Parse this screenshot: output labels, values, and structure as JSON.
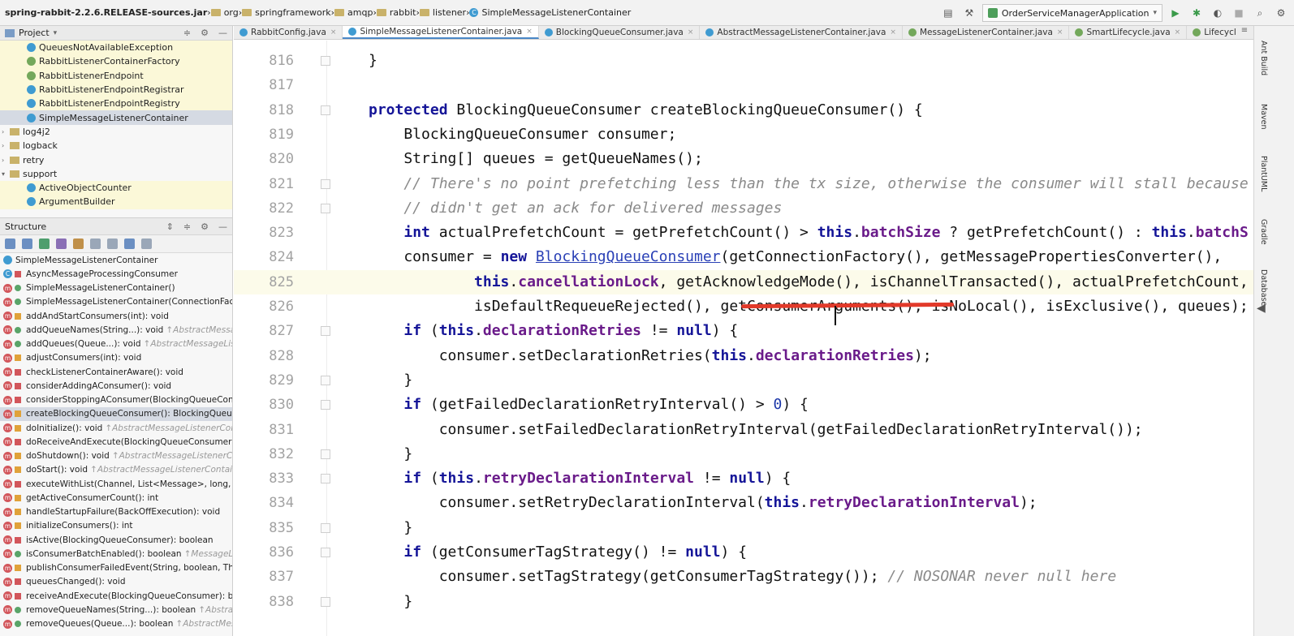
{
  "breadcrumbs": [
    {
      "label": "spring-rabbit-2.2.6.RELEASE-sources.jar",
      "kind": "jar"
    },
    {
      "label": "org",
      "kind": "folder"
    },
    {
      "label": "springframework",
      "kind": "folder"
    },
    {
      "label": "amqp",
      "kind": "folder"
    },
    {
      "label": "rabbit",
      "kind": "folder"
    },
    {
      "label": "listener",
      "kind": "folder"
    },
    {
      "label": "SimpleMessageListenerContainer",
      "kind": "class"
    }
  ],
  "run_config": {
    "label": "OrderServiceManagerApplication"
  },
  "project_panel": {
    "title": "Project",
    "tree": [
      {
        "label": "QueuesNotAvailableException",
        "icon": "class-icon"
      },
      {
        "label": "RabbitListenerContainerFactory",
        "icon": "interface-icon"
      },
      {
        "label": "RabbitListenerEndpoint",
        "icon": "interface-icon"
      },
      {
        "label": "RabbitListenerEndpointRegistrar",
        "icon": "class-icon"
      },
      {
        "label": "RabbitListenerEndpointRegistry",
        "icon": "class-icon"
      },
      {
        "label": "SimpleMessageListenerContainer",
        "icon": "class-icon",
        "selected": true
      },
      {
        "label": "log4j2",
        "icon": "folder-icon"
      },
      {
        "label": "logback",
        "icon": "folder-icon"
      },
      {
        "label": "retry",
        "icon": "folder-icon"
      },
      {
        "label": "support",
        "icon": "folder-icon",
        "expanded": true
      },
      {
        "label": "ActiveObjectCounter",
        "icon": "class-icon"
      },
      {
        "label": "ArgumentBuilder",
        "icon": "class-icon"
      }
    ]
  },
  "structure_panel": {
    "title": "Structure",
    "root": "SimpleMessageListenerContainer",
    "items": [
      {
        "label": "AsyncMessageProcessingConsumer",
        "source": "",
        "vis": "priv",
        "kind": "class"
      },
      {
        "label": "SimpleMessageListenerContainer()",
        "source": "",
        "vis": "pub"
      },
      {
        "label": "SimpleMessageListenerContainer(ConnectionFactory)",
        "source": "",
        "vis": "pub"
      },
      {
        "label": "addAndStartConsumers(int): void",
        "source": "",
        "vis": "prot"
      },
      {
        "label": "addQueueNames(String...): void",
        "source": "↑AbstractMessageListenerContainer",
        "vis": "pub"
      },
      {
        "label": "addQueues(Queue...): void",
        "source": "↑AbstractMessageListenerContainer",
        "vis": "pub"
      },
      {
        "label": "adjustConsumers(int): void",
        "source": "",
        "vis": "prot"
      },
      {
        "label": "checkListenerContainerAware(): void",
        "source": "",
        "vis": "priv"
      },
      {
        "label": "considerAddingAConsumer(): void",
        "source": "",
        "vis": "priv"
      },
      {
        "label": "considerStoppingAConsumer(BlockingQueueConsumer): void",
        "source": "",
        "vis": "priv"
      },
      {
        "label": "createBlockingQueueConsumer(): BlockingQueueConsumer",
        "source": "",
        "vis": "prot",
        "selected": true
      },
      {
        "label": "doInitialize(): void",
        "source": "↑AbstractMessageListenerContainer",
        "vis": "prot"
      },
      {
        "label": "doReceiveAndExecute(BlockingQueueConsumer): boolean",
        "source": "",
        "vis": "priv"
      },
      {
        "label": "doShutdown(): void",
        "source": "↑AbstractMessageListenerContainer",
        "vis": "prot"
      },
      {
        "label": "doStart(): void",
        "source": "↑AbstractMessageListenerContainer",
        "vis": "prot"
      },
      {
        "label": "executeWithList(Channel, List<Message>, long, BlockingQueueConsumer)",
        "source": "",
        "vis": "priv"
      },
      {
        "label": "getActiveConsumerCount(): int",
        "source": "",
        "vis": "prot"
      },
      {
        "label": "handleStartupFailure(BackOffExecution): void",
        "source": "",
        "vis": "prot"
      },
      {
        "label": "initializeConsumers(): int",
        "source": "",
        "vis": "prot"
      },
      {
        "label": "isActive(BlockingQueueConsumer): boolean",
        "source": "",
        "vis": "priv"
      },
      {
        "label": "isConsumerBatchEnabled(): boolean",
        "source": "↑MessageListenerContainer",
        "vis": "pub"
      },
      {
        "label": "publishConsumerFailedEvent(String, boolean, Throwable): void",
        "source": "",
        "vis": "prot"
      },
      {
        "label": "queuesChanged(): void",
        "source": "",
        "vis": "priv"
      },
      {
        "label": "receiveAndExecute(BlockingQueueConsumer): boolean",
        "source": "",
        "vis": "priv"
      },
      {
        "label": "removeQueueNames(String...): boolean",
        "source": "↑AbstractMessageListenerContainer",
        "vis": "pub"
      },
      {
        "label": "removeQueues(Queue...): boolean",
        "source": "↑AbstractMessageListenerContainer",
        "vis": "pub"
      }
    ]
  },
  "editor_tabs": [
    {
      "label": "RabbitConfig.java",
      "icon": "class"
    },
    {
      "label": "SimpleMessageListenerContainer.java",
      "icon": "class",
      "active": true
    },
    {
      "label": "BlockingQueueConsumer.java",
      "icon": "class"
    },
    {
      "label": "AbstractMessageListenerContainer.java",
      "icon": "class"
    },
    {
      "label": "MessageListenerContainer.java",
      "icon": "interface"
    },
    {
      "label": "SmartLifecycle.java",
      "icon": "interface"
    },
    {
      "label": "Lifecycle.java",
      "icon": "interface"
    }
  ],
  "right_tools": [
    "Ant Build",
    "Maven",
    "PlantUML",
    "Gradle",
    "Database"
  ],
  "code": {
    "current_line": "825",
    "lines": [
      {
        "n": "816",
        "fold": true,
        "tokens": [
          {
            "t": "}",
            "c": ""
          }
        ]
      },
      {
        "n": "817",
        "fold": false,
        "tokens": []
      },
      {
        "n": "818",
        "fold": true,
        "tokens": [
          {
            "t": "protected ",
            "c": "kw"
          },
          {
            "t": "BlockingQueueConsumer createBlockingQueueConsumer() {",
            "c": ""
          }
        ]
      },
      {
        "n": "819",
        "fold": false,
        "tokens": [
          {
            "t": "    BlockingQueueConsumer consumer;",
            "c": ""
          }
        ]
      },
      {
        "n": "820",
        "fold": false,
        "tokens": [
          {
            "t": "    String[] queues = getQueueNames();",
            "c": ""
          }
        ]
      },
      {
        "n": "821",
        "fold": true,
        "tokens": [
          {
            "t": "    // There's no point prefetching less than the tx size, otherwise the consumer will stall because t",
            "c": "cmt"
          }
        ]
      },
      {
        "n": "822",
        "fold": true,
        "tokens": [
          {
            "t": "    // didn't get an ack for delivered messages",
            "c": "cmt"
          }
        ]
      },
      {
        "n": "823",
        "fold": false,
        "tokens": [
          {
            "t": "    ",
            "c": ""
          },
          {
            "t": "int ",
            "c": "kw"
          },
          {
            "t": "actualPrefetchCount = getPrefetchCount() > ",
            "c": ""
          },
          {
            "t": "this",
            "c": "kw"
          },
          {
            "t": ".",
            "c": ""
          },
          {
            "t": "batchSize",
            "c": "fld"
          },
          {
            "t": " ? getPrefetchCount() : ",
            "c": ""
          },
          {
            "t": "this",
            "c": "kw"
          },
          {
            "t": ".",
            "c": ""
          },
          {
            "t": "batchS",
            "c": "fld"
          }
        ]
      },
      {
        "n": "824",
        "fold": false,
        "tokens": [
          {
            "t": "    consumer = ",
            "c": ""
          },
          {
            "t": "new ",
            "c": "kw"
          },
          {
            "t": "BlockingQueueConsumer",
            "c": "ref"
          },
          {
            "t": "(getConnectionFactory(), getMessagePropertiesConverter(),",
            "c": ""
          }
        ]
      },
      {
        "n": "825",
        "fold": false,
        "tokens": [
          {
            "t": "            ",
            "c": ""
          },
          {
            "t": "this",
            "c": "kw"
          },
          {
            "t": ".",
            "c": ""
          },
          {
            "t": "cancellationLock",
            "c": "fld"
          },
          {
            "t": ", getAcknowledgeMode(), isChannelTransacted(), actualPrefetchCount,",
            "c": ""
          }
        ]
      },
      {
        "n": "826",
        "fold": false,
        "tokens": [
          {
            "t": "            isDefaultRequeueRejected(), getConsumerArguments(), isNoLocal(), isExclusive(), queues);",
            "c": ""
          }
        ]
      },
      {
        "n": "827",
        "fold": true,
        "tokens": [
          {
            "t": "    ",
            "c": ""
          },
          {
            "t": "if ",
            "c": "kw"
          },
          {
            "t": "(",
            "c": ""
          },
          {
            "t": "this",
            "c": "kw"
          },
          {
            "t": ".",
            "c": ""
          },
          {
            "t": "declarationRetries",
            "c": "fld"
          },
          {
            "t": " != ",
            "c": ""
          },
          {
            "t": "null",
            "c": "kw"
          },
          {
            "t": ") {",
            "c": ""
          }
        ]
      },
      {
        "n": "828",
        "fold": false,
        "tokens": [
          {
            "t": "        consumer.setDeclarationRetries(",
            "c": ""
          },
          {
            "t": "this",
            "c": "kw"
          },
          {
            "t": ".",
            "c": ""
          },
          {
            "t": "declarationRetries",
            "c": "fld"
          },
          {
            "t": ");",
            "c": ""
          }
        ]
      },
      {
        "n": "829",
        "fold": true,
        "tokens": [
          {
            "t": "    }",
            "c": ""
          }
        ]
      },
      {
        "n": "830",
        "fold": true,
        "tokens": [
          {
            "t": "    ",
            "c": ""
          },
          {
            "t": "if ",
            "c": "kw"
          },
          {
            "t": "(getFailedDeclarationRetryInterval() > ",
            "c": ""
          },
          {
            "t": "0",
            "c": "num"
          },
          {
            "t": ") {",
            "c": ""
          }
        ]
      },
      {
        "n": "831",
        "fold": false,
        "tokens": [
          {
            "t": "        consumer.setFailedDeclarationRetryInterval(getFailedDeclarationRetryInterval());",
            "c": ""
          }
        ]
      },
      {
        "n": "832",
        "fold": true,
        "tokens": [
          {
            "t": "    }",
            "c": ""
          }
        ]
      },
      {
        "n": "833",
        "fold": true,
        "tokens": [
          {
            "t": "    ",
            "c": ""
          },
          {
            "t": "if ",
            "c": "kw"
          },
          {
            "t": "(",
            "c": ""
          },
          {
            "t": "this",
            "c": "kw"
          },
          {
            "t": ".",
            "c": ""
          },
          {
            "t": "retryDeclarationInterval",
            "c": "fld"
          },
          {
            "t": " != ",
            "c": ""
          },
          {
            "t": "null",
            "c": "kw"
          },
          {
            "t": ") {",
            "c": ""
          }
        ]
      },
      {
        "n": "834",
        "fold": false,
        "tokens": [
          {
            "t": "        consumer.setRetryDeclarationInterval(",
            "c": ""
          },
          {
            "t": "this",
            "c": "kw"
          },
          {
            "t": ".",
            "c": ""
          },
          {
            "t": "retryDeclarationInterval",
            "c": "fld"
          },
          {
            "t": ");",
            "c": ""
          }
        ]
      },
      {
        "n": "835",
        "fold": true,
        "tokens": [
          {
            "t": "    }",
            "c": ""
          }
        ]
      },
      {
        "n": "836",
        "fold": true,
        "tokens": [
          {
            "t": "    ",
            "c": ""
          },
          {
            "t": "if ",
            "c": "kw"
          },
          {
            "t": "(getConsumerTagStrategy() != ",
            "c": ""
          },
          {
            "t": "null",
            "c": "kw"
          },
          {
            "t": ") {",
            "c": ""
          }
        ]
      },
      {
        "n": "837",
        "fold": false,
        "tokens": [
          {
            "t": "        consumer.setTagStrategy(getConsumerTagStrategy()); ",
            "c": ""
          },
          {
            "t": "// NOSONAR never null here",
            "c": "cmt"
          }
        ]
      },
      {
        "n": "838",
        "fold": true,
        "tokens": [
          {
            "t": "    }",
            "c": ""
          }
        ]
      }
    ]
  }
}
